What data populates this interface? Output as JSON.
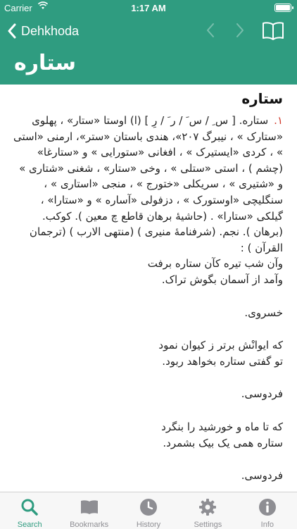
{
  "status": {
    "carrier": "Carrier",
    "time": "1:17 AM",
    "battery_level": 0.9
  },
  "nav": {
    "back_label": "Dehkhoda"
  },
  "page_title": "ستاره",
  "entry": {
    "headword": "ستاره",
    "number": "۱.",
    "definition": "ستاره. [ س ِ / س َ / ر َ / رِ ] (ا) اوستا «ستار» ، پهلوی «ستارک » ، نیبرگ ۲۰۷»، هندی باستان «ستر»، ارمنی «استی » ، کردی «ایستیرک » ، افغانی «ستورایی » و «ستارغا» (چشم ) ، استی «ستلی » ، وخی «ستار» ، شغنی «شتاری » و «شتیری » ، سریکلی «ختورج » ، منجی «استاری » ، سنگلیچی «اوستورک » ، دزفولی «آساره » و «ستارا» ، گیلکی «ستارا» . (حاشیهٔ برهان قاطع چ معین ). کوکب. (برهان ). نجم. (شرفنامهٔ منیری ) (منتهی الارب ) (ترجمان القرآن ) :",
    "verse1_line1": "وآن شب تیره کآن ستاره برفت",
    "verse1_line2": "وآمد از آسمان بگوش تراک.",
    "poet1": "خسروی.",
    "verse2_line1": "که ایوانْش برتر ز کیوان نمود",
    "verse2_line2": "تو گفتی ستاره بخواهد ربود.",
    "poet2": "فردوسی.",
    "verse3_line1": "که تا ماه و خورشید را بنگرد",
    "verse3_line2": "ستاره همی یک بیک بشمرد.",
    "poet3": "فردوسی."
  },
  "tabs": [
    {
      "label": "Search",
      "icon": "search-icon",
      "active": true
    },
    {
      "label": "Bookmarks",
      "icon": "bookmarks-icon",
      "active": false
    },
    {
      "label": "History",
      "icon": "history-icon",
      "active": false
    },
    {
      "label": "Settings",
      "icon": "settings-icon",
      "active": false
    },
    {
      "label": "Info",
      "icon": "info-icon",
      "active": false
    }
  ],
  "colors": {
    "accent": "#2f9c80",
    "number": "#d0392b",
    "tab_inactive": "#8e8e93"
  }
}
